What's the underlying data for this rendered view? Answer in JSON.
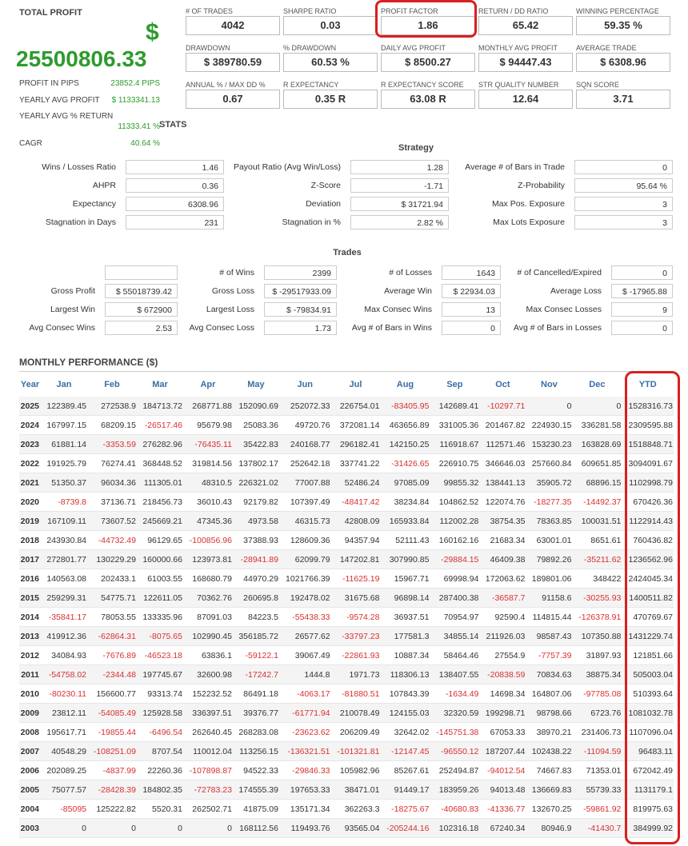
{
  "summary": {
    "total_profit_label": "TOTAL PROFIT",
    "dollar_sign": "$",
    "total_profit": "25500806.33",
    "rows": [
      {
        "label": "PROFIT IN PIPS",
        "value": "23852.4 PIPS"
      },
      {
        "label": "YEARLY AVG PROFIT",
        "value": "$ 1133341.13"
      },
      {
        "label": "YEARLY AVG % RETURN",
        "value": "11333.41 %"
      },
      {
        "label": "CAGR",
        "value": "40.64 %"
      }
    ]
  },
  "metrics": [
    {
      "label": "# OF TRADES",
      "value": "4042"
    },
    {
      "label": "SHARPE RATIO",
      "value": "0.03"
    },
    {
      "label": "PROFIT FACTOR",
      "value": "1.86"
    },
    {
      "label": "RETURN / DD RATIO",
      "value": "65.42"
    },
    {
      "label": "WINNING PERCENTAGE",
      "value": "59.35 %"
    },
    {
      "label": "DRAWDOWN",
      "value": "$ 389780.59"
    },
    {
      "label": "% DRAWDOWN",
      "value": "60.53 %"
    },
    {
      "label": "DAILY AVG PROFIT",
      "value": "$ 8500.27"
    },
    {
      "label": "MONTHLY AVG PROFIT",
      "value": "$ 94447.43"
    },
    {
      "label": "AVERAGE TRADE",
      "value": "$ 6308.96"
    },
    {
      "label": "ANNUAL % / MAX DD %",
      "value": "0.67"
    },
    {
      "label": "R EXPECTANCY",
      "value": "0.35 R"
    },
    {
      "label": "R EXPECTANCY SCORE",
      "value": "63.08 R"
    },
    {
      "label": "STR QUALITY NUMBER",
      "value": "12.64"
    },
    {
      "label": "SQN SCORE",
      "value": "3.71"
    }
  ],
  "stats": {
    "title": "STATS",
    "strategy_title": "Strategy",
    "rows": [
      [
        {
          "label": "Wins / Losses Ratio",
          "value": "1.46"
        },
        {
          "label": "Payout Ratio (Avg Win/Loss)",
          "value": "1.28"
        },
        {
          "label": "Average # of Bars in Trade",
          "value": "0"
        }
      ],
      [
        {
          "label": "AHPR",
          "value": "0.36"
        },
        {
          "label": "Z-Score",
          "value": "-1.71"
        },
        {
          "label": "Z-Probability",
          "value": "95.64 %"
        }
      ],
      [
        {
          "label": "Expectancy",
          "value": "6308.96"
        },
        {
          "label": "Deviation",
          "value": "$ 31721.94"
        },
        {
          "label": "Max Pos. Exposure",
          "value": "3"
        }
      ],
      [
        {
          "label": "Stagnation in Days",
          "value": "231"
        },
        {
          "label": "Stagnation in %",
          "value": "2.82 %"
        },
        {
          "label": "Max Lots Exposure",
          "value": "3"
        }
      ]
    ]
  },
  "trades": {
    "title": "Trades",
    "rows": [
      [
        {
          "label": "",
          "value": ""
        },
        {
          "label": "# of Wins",
          "value": "2399"
        },
        {
          "label": "# of Losses",
          "value": "1643"
        },
        {
          "label": "# of Cancelled/Expired",
          "value": "0"
        }
      ],
      [
        {
          "label": "Gross Profit",
          "value": "$ 55018739.42"
        },
        {
          "label": "Gross Loss",
          "value": "$ -29517933.09"
        },
        {
          "label": "Average Win",
          "value": "$ 22934.03"
        },
        {
          "label": "Average Loss",
          "value": "$ -17965.88"
        }
      ],
      [
        {
          "label": "Largest Win",
          "value": "$ 672900"
        },
        {
          "label": "Largest Loss",
          "value": "$ -79834.91"
        },
        {
          "label": "Max Consec Wins",
          "value": "13"
        },
        {
          "label": "Max Consec Losses",
          "value": "9"
        }
      ],
      [
        {
          "label": "Avg Consec Wins",
          "value": "2.53"
        },
        {
          "label": "Avg Consec Loss",
          "value": "1.73"
        },
        {
          "label": "Avg # of Bars in Wins",
          "value": "0"
        },
        {
          "label": "Avg # of Bars in Losses",
          "value": "0"
        }
      ]
    ]
  },
  "monthly": {
    "title": "MONTHLY PERFORMANCE ($)",
    "headers": [
      "Year",
      "Jan",
      "Feb",
      "Mar",
      "Apr",
      "May",
      "Jun",
      "Jul",
      "Aug",
      "Sep",
      "Oct",
      "Nov",
      "Dec",
      "YTD"
    ],
    "rows": [
      [
        "2025",
        "122389.45",
        "272538.9",
        "184713.72",
        "268771.88",
        "152090.69",
        "252072.33",
        "226754.01",
        "-83405.95",
        "142689.41",
        "-10297.71",
        "0",
        "0",
        "1528316.73"
      ],
      [
        "2024",
        "167997.15",
        "68209.15",
        "-26517.46",
        "95679.98",
        "25083.36",
        "49720.76",
        "372081.14",
        "463656.89",
        "331005.36",
        "201467.82",
        "224930.15",
        "336281.58",
        "2309595.88"
      ],
      [
        "2023",
        "61881.14",
        "-3353.59",
        "276282.96",
        "-76435.11",
        "35422.83",
        "240168.77",
        "296182.41",
        "142150.25",
        "116918.67",
        "112571.46",
        "153230.23",
        "163828.69",
        "1518848.71"
      ],
      [
        "2022",
        "191925.79",
        "76274.41",
        "368448.52",
        "319814.56",
        "137802.17",
        "252642.18",
        "337741.22",
        "-31426.65",
        "226910.75",
        "346646.03",
        "257660.84",
        "609651.85",
        "3094091.67"
      ],
      [
        "2021",
        "51350.37",
        "96034.36",
        "111305.01",
        "48310.5",
        "226321.02",
        "77007.88",
        "52486.24",
        "97085.09",
        "99855.32",
        "138441.13",
        "35905.72",
        "68896.15",
        "1102998.79"
      ],
      [
        "2020",
        "-8739.8",
        "37136.71",
        "218456.73",
        "36010.43",
        "92179.82",
        "107397.49",
        "-48417.42",
        "38234.84",
        "104862.52",
        "122074.76",
        "-18277.35",
        "-14492.37",
        "670426.36"
      ],
      [
        "2019",
        "167109.11",
        "73607.52",
        "245669.21",
        "47345.36",
        "4973.58",
        "46315.73",
        "42808.09",
        "165933.84",
        "112002.28",
        "38754.35",
        "78363.85",
        "100031.51",
        "1122914.43"
      ],
      [
        "2018",
        "243930.84",
        "-44732.49",
        "96129.65",
        "-100856.96",
        "37388.93",
        "128609.36",
        "94357.94",
        "52111.43",
        "160162.16",
        "21683.34",
        "63001.01",
        "8651.61",
        "760436.82"
      ],
      [
        "2017",
        "272801.77",
        "130229.29",
        "160000.66",
        "123973.81",
        "-28941.89",
        "62099.79",
        "147202.81",
        "307990.85",
        "-29884.15",
        "46409.38",
        "79892.26",
        "-35211.62",
        "1236562.96"
      ],
      [
        "2016",
        "140563.08",
        "202433.1",
        "61003.55",
        "168680.79",
        "44970.29",
        "1021766.39",
        "-11625.19",
        "15967.71",
        "69998.94",
        "172063.62",
        "189801.06",
        "348422",
        "2424045.34"
      ],
      [
        "2015",
        "259299.31",
        "54775.71",
        "122611.05",
        "70362.76",
        "260695.8",
        "192478.02",
        "31675.68",
        "96898.14",
        "287400.38",
        "-36587.7",
        "91158.6",
        "-30255.93",
        "1400511.82"
      ],
      [
        "2014",
        "-35841.17",
        "78053.55",
        "133335.96",
        "87091.03",
        "84223.5",
        "-55438.33",
        "-9574.28",
        "36937.51",
        "70954.97",
        "92590.4",
        "114815.44",
        "-126378.91",
        "470769.67"
      ],
      [
        "2013",
        "419912.36",
        "-62864.31",
        "-8075.65",
        "102990.45",
        "356185.72",
        "26577.62",
        "-33797.23",
        "177581.3",
        "34855.14",
        "211926.03",
        "98587.43",
        "107350.88",
        "1431229.74"
      ],
      [
        "2012",
        "34084.93",
        "-7676.89",
        "-46523.18",
        "63836.1",
        "-59122.1",
        "39067.49",
        "-22861.93",
        "10887.34",
        "58464.46",
        "27554.9",
        "-7757.39",
        "31897.93",
        "121851.66"
      ],
      [
        "2011",
        "-54758.02",
        "-2344.48",
        "197745.67",
        "32600.98",
        "-17242.7",
        "1444.8",
        "1971.73",
        "118306.13",
        "138407.55",
        "-20838.59",
        "70834.63",
        "38875.34",
        "505003.04"
      ],
      [
        "2010",
        "-80230.11",
        "156600.77",
        "93313.74",
        "152232.52",
        "86491.18",
        "-4063.17",
        "-81880.51",
        "107843.39",
        "-1634.49",
        "14698.34",
        "164807.06",
        "-97785.08",
        "510393.64"
      ],
      [
        "2009",
        "23812.11",
        "-54085.49",
        "125928.58",
        "336397.51",
        "39376.77",
        "-61771.94",
        "210078.49",
        "124155.03",
        "32320.59",
        "199298.71",
        "98798.66",
        "6723.76",
        "1081032.78"
      ],
      [
        "2008",
        "195617.71",
        "-19855.44",
        "-6496.54",
        "262640.45",
        "268283.08",
        "-23623.62",
        "206209.49",
        "32642.02",
        "-145751.38",
        "67053.33",
        "38970.21",
        "231406.73",
        "1107096.04"
      ],
      [
        "2007",
        "40548.29",
        "-108251.09",
        "8707.54",
        "110012.04",
        "113256.15",
        "-136321.51",
        "-101321.81",
        "-12147.45",
        "-96550.12",
        "187207.44",
        "102438.22",
        "-11094.59",
        "96483.11"
      ],
      [
        "2006",
        "202089.25",
        "-4837.99",
        "22260.36",
        "-107898.87",
        "94522.33",
        "-29846.33",
        "105982.96",
        "85267.61",
        "252494.87",
        "-94012.54",
        "74667.83",
        "71353.01",
        "672042.49"
      ],
      [
        "2005",
        "75077.57",
        "-28428.39",
        "184802.35",
        "-72783.23",
        "174555.39",
        "197653.33",
        "38471.01",
        "91449.17",
        "183959.26",
        "94013.48",
        "136669.83",
        "55739.33",
        "1131179.1"
      ],
      [
        "2004",
        "-85095",
        "125222.82",
        "5520.31",
        "262502.71",
        "41875.09",
        "135171.34",
        "362263.3",
        "-18275.67",
        "-40680.83",
        "-41336.77",
        "132670.25",
        "-59861.92",
        "819975.63"
      ],
      [
        "2003",
        "0",
        "0",
        "0",
        "0",
        "168112.56",
        "119493.76",
        "93565.04",
        "-205244.16",
        "102316.18",
        "67240.34",
        "80946.9",
        "-41430.7",
        "384999.92"
      ]
    ]
  },
  "colors": {
    "profit_green": "#2e9b2e",
    "negative_red": "#d83030",
    "highlight_red": "#d82020",
    "header_blue": "#3a6ea5"
  }
}
